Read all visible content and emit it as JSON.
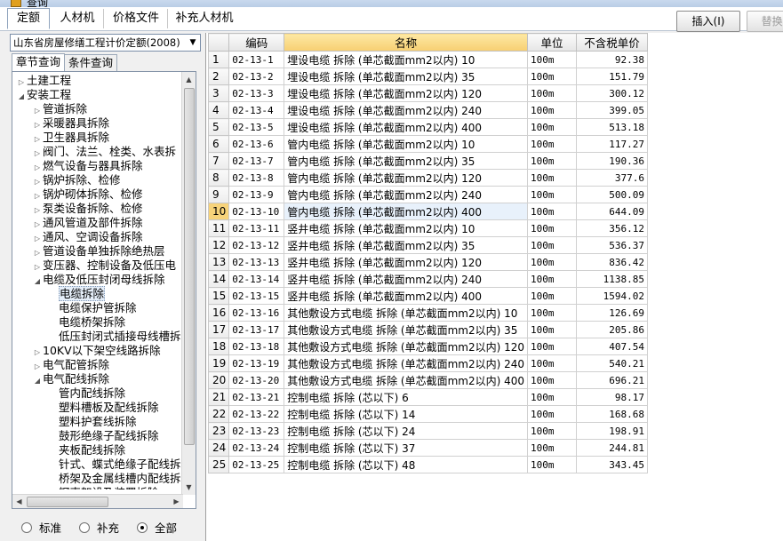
{
  "window": {
    "title": "查询"
  },
  "tabs": [
    {
      "label": "定额",
      "active": true
    },
    {
      "label": "人材机",
      "active": false
    },
    {
      "label": "价格文件",
      "active": false
    },
    {
      "label": "补充人材机",
      "active": false
    }
  ],
  "toolbar": {
    "insert_label": "插入(I)",
    "replace_label": "替换("
  },
  "left": {
    "quota_library": "山东省房屋修缮工程计价定额(2008)",
    "subtabs": [
      {
        "label": "章节查询",
        "active": true
      },
      {
        "label": "条件查询",
        "active": false
      }
    ],
    "tree": [
      {
        "label": "土建工程",
        "level": 0,
        "state": "collapsed"
      },
      {
        "label": "安装工程",
        "level": 0,
        "state": "expanded"
      },
      {
        "label": "管道拆除",
        "level": 1,
        "state": "collapsed"
      },
      {
        "label": "采暖器具拆除",
        "level": 1,
        "state": "collapsed"
      },
      {
        "label": "卫生器具拆除",
        "level": 1,
        "state": "collapsed"
      },
      {
        "label": "阀门、法兰、栓类、水表拆",
        "level": 1,
        "state": "collapsed"
      },
      {
        "label": "燃气设备与器具拆除",
        "level": 1,
        "state": "collapsed"
      },
      {
        "label": "锅炉拆除、检修",
        "level": 1,
        "state": "collapsed"
      },
      {
        "label": "锅炉砌体拆除、检修",
        "level": 1,
        "state": "collapsed"
      },
      {
        "label": "泵类设备拆除、检修",
        "level": 1,
        "state": "collapsed"
      },
      {
        "label": "通风管道及部件拆除",
        "level": 1,
        "state": "collapsed"
      },
      {
        "label": "通风、空调设备拆除",
        "level": 1,
        "state": "collapsed"
      },
      {
        "label": "管道设备单独拆除绝热层",
        "level": 1,
        "state": "collapsed"
      },
      {
        "label": "变压器、控制设备及低压电",
        "level": 1,
        "state": "collapsed"
      },
      {
        "label": "电缆及低压封闭母线拆除",
        "level": 1,
        "state": "expanded"
      },
      {
        "label": "电缆拆除",
        "level": 2,
        "state": "leaf",
        "selected": true
      },
      {
        "label": "电缆保护管拆除",
        "level": 2,
        "state": "leaf"
      },
      {
        "label": "电缆桥架拆除",
        "level": 2,
        "state": "leaf"
      },
      {
        "label": "低压封闭式插接母线槽拆",
        "level": 2,
        "state": "leaf"
      },
      {
        "label": "10KV以下架空线路拆除",
        "level": 1,
        "state": "collapsed"
      },
      {
        "label": "电气配管拆除",
        "level": 1,
        "state": "collapsed"
      },
      {
        "label": "电气配线拆除",
        "level": 1,
        "state": "expanded"
      },
      {
        "label": "管内配线拆除",
        "level": 2,
        "state": "leaf"
      },
      {
        "label": "塑料槽板及配线拆除",
        "level": 2,
        "state": "leaf"
      },
      {
        "label": "塑料护套线拆除",
        "level": 2,
        "state": "leaf"
      },
      {
        "label": "鼓形绝缘子配线拆除",
        "level": 2,
        "state": "leaf"
      },
      {
        "label": "夹板配线拆除",
        "level": 2,
        "state": "leaf"
      },
      {
        "label": "针式、蝶式绝缘子配线拆",
        "level": 2,
        "state": "leaf"
      },
      {
        "label": "桥架及金属线槽内配线拆",
        "level": 2,
        "state": "leaf"
      },
      {
        "label": "钢索架设及装置拆除",
        "level": 2,
        "state": "leaf"
      }
    ],
    "filter": [
      {
        "label": "标准",
        "checked": false
      },
      {
        "label": "补充",
        "checked": false
      },
      {
        "label": "全部",
        "checked": true
      }
    ]
  },
  "grid": {
    "columns": [
      "",
      "编码",
      "名称",
      "单位",
      "不含税单价"
    ],
    "current_row": 10,
    "rows": [
      {
        "no": "1",
        "code": "02-13-1",
        "name": "埋设电缆 拆除 (单芯截面mm2以内) 10",
        "unit": "100m",
        "price": "92.38"
      },
      {
        "no": "2",
        "code": "02-13-2",
        "name": "埋设电缆 拆除 (单芯截面mm2以内) 35",
        "unit": "100m",
        "price": "151.79"
      },
      {
        "no": "3",
        "code": "02-13-3",
        "name": "埋设电缆 拆除 (单芯截面mm2以内) 120",
        "unit": "100m",
        "price": "300.12"
      },
      {
        "no": "4",
        "code": "02-13-4",
        "name": "埋设电缆 拆除 (单芯截面mm2以内) 240",
        "unit": "100m",
        "price": "399.05"
      },
      {
        "no": "5",
        "code": "02-13-5",
        "name": "埋设电缆 拆除 (单芯截面mm2以内) 400",
        "unit": "100m",
        "price": "513.18"
      },
      {
        "no": "6",
        "code": "02-13-6",
        "name": "管内电缆 拆除 (单芯截面mm2以内) 10",
        "unit": "100m",
        "price": "117.27"
      },
      {
        "no": "7",
        "code": "02-13-7",
        "name": "管内电缆 拆除 (单芯截面mm2以内) 35",
        "unit": "100m",
        "price": "190.36"
      },
      {
        "no": "8",
        "code": "02-13-8",
        "name": "管内电缆 拆除 (单芯截面mm2以内) 120",
        "unit": "100m",
        "price": "377.6"
      },
      {
        "no": "9",
        "code": "02-13-9",
        "name": "管内电缆 拆除 (单芯截面mm2以内) 240",
        "unit": "100m",
        "price": "500.09"
      },
      {
        "no": "10",
        "code": "02-13-10",
        "name": "管内电缆 拆除 (单芯截面mm2以内) 400",
        "unit": "100m",
        "price": "644.09"
      },
      {
        "no": "11",
        "code": "02-13-11",
        "name": "竖井电缆 拆除 (单芯截面mm2以内) 10",
        "unit": "100m",
        "price": "356.12"
      },
      {
        "no": "12",
        "code": "02-13-12",
        "name": "竖井电缆 拆除 (单芯截面mm2以内) 35",
        "unit": "100m",
        "price": "536.37"
      },
      {
        "no": "13",
        "code": "02-13-13",
        "name": "竖井电缆 拆除 (单芯截面mm2以内) 120",
        "unit": "100m",
        "price": "836.42"
      },
      {
        "no": "14",
        "code": "02-13-14",
        "name": "竖井电缆 拆除 (单芯截面mm2以内) 240",
        "unit": "100m",
        "price": "1138.85"
      },
      {
        "no": "15",
        "code": "02-13-15",
        "name": "竖井电缆 拆除 (单芯截面mm2以内) 400",
        "unit": "100m",
        "price": "1594.02"
      },
      {
        "no": "16",
        "code": "02-13-16",
        "name": "其他敷设方式电缆 拆除 (单芯截面mm2以内) 10",
        "unit": "100m",
        "price": "126.69"
      },
      {
        "no": "17",
        "code": "02-13-17",
        "name": "其他敷设方式电缆 拆除 (单芯截面mm2以内) 35",
        "unit": "100m",
        "price": "205.86"
      },
      {
        "no": "18",
        "code": "02-13-18",
        "name": "其他敷设方式电缆 拆除 (单芯截面mm2以内) 120",
        "unit": "100m",
        "price": "407.54"
      },
      {
        "no": "19",
        "code": "02-13-19",
        "name": "其他敷设方式电缆 拆除 (单芯截面mm2以内) 240",
        "unit": "100m",
        "price": "540.21"
      },
      {
        "no": "20",
        "code": "02-13-20",
        "name": "其他敷设方式电缆 拆除 (单芯截面mm2以内) 400",
        "unit": "100m",
        "price": "696.21"
      },
      {
        "no": "21",
        "code": "02-13-21",
        "name": "控制电缆 拆除 (芯以下) 6",
        "unit": "100m",
        "price": "98.17"
      },
      {
        "no": "22",
        "code": "02-13-22",
        "name": "控制电缆 拆除 (芯以下) 14",
        "unit": "100m",
        "price": "168.68"
      },
      {
        "no": "23",
        "code": "02-13-23",
        "name": "控制电缆 拆除 (芯以下) 24",
        "unit": "100m",
        "price": "198.91"
      },
      {
        "no": "24",
        "code": "02-13-24",
        "name": "控制电缆 拆除 (芯以下) 37",
        "unit": "100m",
        "price": "244.81"
      },
      {
        "no": "25",
        "code": "02-13-25",
        "name": "控制电缆 拆除 (芯以下) 48",
        "unit": "100m",
        "price": "343.45"
      }
    ]
  }
}
